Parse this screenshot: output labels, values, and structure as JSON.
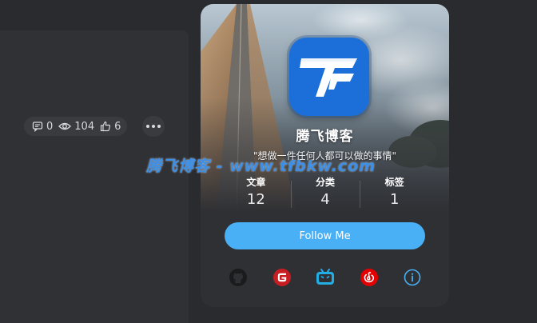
{
  "post_meta": {
    "comments": "0",
    "views": "104",
    "likes": "6"
  },
  "profile": {
    "name": "腾飞博客",
    "motto": "\"想做一件任何人都可以做的事情\"",
    "stats": [
      {
        "label": "文章",
        "value": "12"
      },
      {
        "label": "分类",
        "value": "4"
      },
      {
        "label": "标签",
        "value": "1"
      }
    ],
    "follow_label": "Follow Me",
    "socials": [
      {
        "icon": "github-icon",
        "color": "#1b1b1d"
      },
      {
        "icon": "gitee-icon",
        "color": "#c71d23"
      },
      {
        "icon": "bilibili-icon",
        "color": "#23ade5"
      },
      {
        "icon": "netease-music-icon",
        "color": "#e20000"
      },
      {
        "icon": "info-icon",
        "color": "#4ab0f5"
      }
    ]
  },
  "watermark": "腾飞博客 - www.tfbkw.com",
  "colors": {
    "accent": "#4ab0f5",
    "logo_bg": "#1c6fd8",
    "card_bg": "#2f3034",
    "page_bg": "#2a2b2e"
  }
}
